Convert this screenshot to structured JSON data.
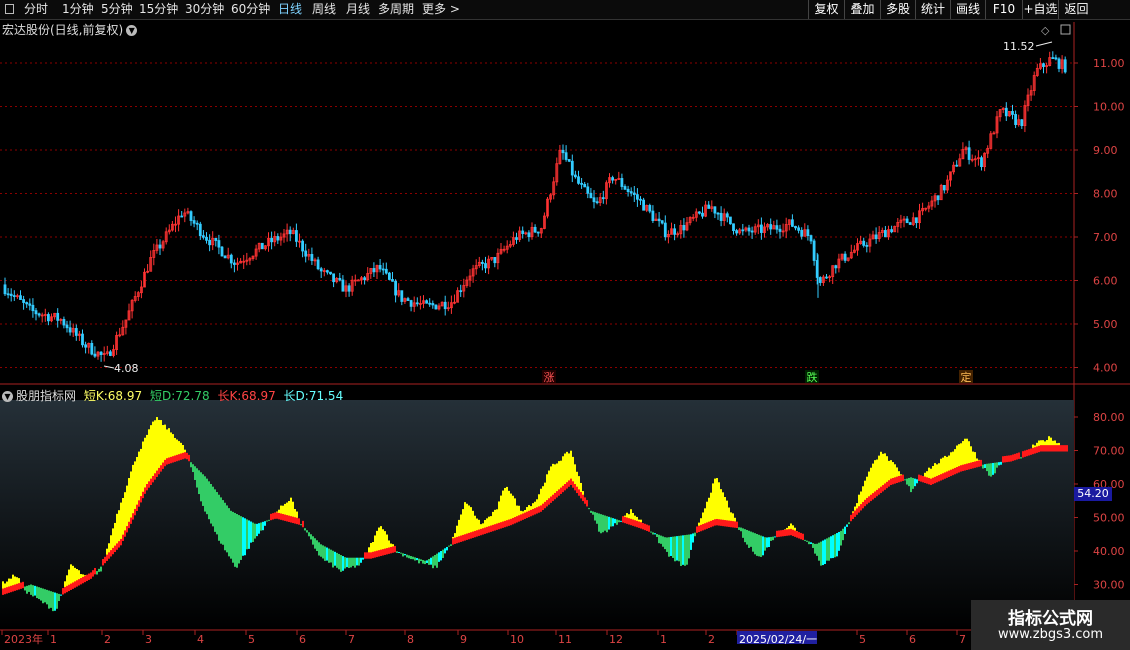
{
  "toolbar": {
    "periods": [
      {
        "label": "分时",
        "active": false
      },
      {
        "label": "1分钟",
        "active": false
      },
      {
        "label": "5分钟",
        "active": false
      },
      {
        "label": "15分钟",
        "active": false
      },
      {
        "label": "30分钟",
        "active": false
      },
      {
        "label": "60分钟",
        "active": false
      },
      {
        "label": "日线",
        "active": true
      },
      {
        "label": "周线",
        "active": false
      },
      {
        "label": "月线",
        "active": false
      },
      {
        "label": "多周期",
        "active": false
      },
      {
        "label": "更多 >",
        "active": false
      }
    ],
    "actions": [
      "复权",
      "叠加",
      "多股",
      "统计",
      "画线",
      "F10",
      "+自选",
      "返回"
    ]
  },
  "price_panel": {
    "title": "宏达股份(日线,前复权)",
    "high_label": "11.52",
    "low_label": "4.08",
    "axis_ticks": [
      "11.00",
      "10.00",
      "9.00",
      "8.00",
      "7.00",
      "6.00",
      "5.00",
      "4.00"
    ],
    "markers": {
      "up": "涨",
      "down": "跌",
      "fix": "定"
    }
  },
  "indicator": {
    "name": "股朋指标网",
    "short_k": {
      "label": "短K:",
      "value": "68.97"
    },
    "short_d": {
      "label": "短D:",
      "value": "72.78"
    },
    "long_k": {
      "label": "长K:",
      "value": "68.97"
    },
    "long_d": {
      "label": "长D:",
      "value": "71.54"
    },
    "axis_ticks": [
      "80.00",
      "70.00",
      "60.00",
      "50.00",
      "40.00",
      "30.00"
    ],
    "current_value": "54.20"
  },
  "time_axis": {
    "labels": [
      "2023年",
      "1",
      "2",
      "3",
      "4",
      "5",
      "6",
      "7",
      "8",
      "9",
      "10",
      "11",
      "12",
      "1",
      "2",
      "2025/02/24/一",
      "5",
      "6",
      "7"
    ]
  },
  "colors": {
    "up": "#ff3333",
    "down": "#33ccff",
    "yellow": "#ffff00",
    "red": "#ff1a1a",
    "green": "#33cc66",
    "cyan": "#00ffff",
    "grid": "#8b0000",
    "active": "#7fd3ff"
  },
  "watermark": {
    "title": "指标公式网",
    "url": "www.zbgs3.com"
  }
}
